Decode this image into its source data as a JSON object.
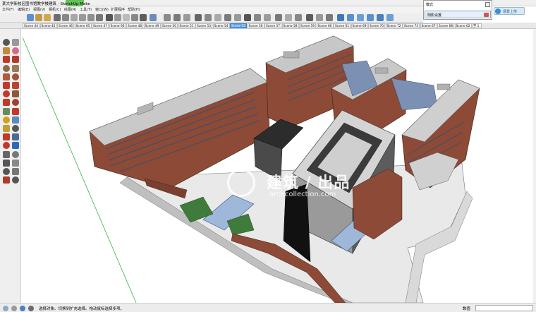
{
  "window": {
    "title": "某大学新校区图书馆教学楼建筑 - SketchUp Make"
  },
  "menu": {
    "items": [
      "文件(F)",
      "编辑(E)",
      "视图(V)",
      "相机(C)",
      "绘图(R)",
      "工具(T)",
      "窗口(W)",
      "扩展程序",
      "帮助(H)"
    ]
  },
  "mode_panel": {
    "label": "模式",
    "shadow_setting": "阴影设置"
  },
  "upload_button": {
    "label": "场景上传"
  },
  "scenes": {
    "tabs": [
      "Scene 44",
      "Scene 45",
      "Scene 46",
      "Scene 65",
      "Scene 47",
      "Scene 66",
      "Scene 48",
      "Scene 49",
      "Scene 50",
      "Scene 51",
      "Scene 53",
      "Scene 54",
      "Scene 55",
      "Scene 56",
      "Scene 57",
      "Scene 58",
      "Scene 59",
      "Scene 60",
      "Scene 61",
      "Scene 69",
      "Scene 70",
      "Scene 72",
      "Scene 73",
      "Scene 67",
      "Scene 68",
      "Scene 62",
      "字 1"
    ],
    "active": "Scene 55"
  },
  "watermark": {
    "cn": "建筑 / 出品",
    "en": "archcollection.com"
  },
  "status": {
    "message": "选择对象。切换到扩充选择。拖动鼠标选择多项。",
    "measure_label": "数值",
    "measure_value": ""
  },
  "colors": {
    "brick": "#8c4a37",
    "roof": "#c7c7c7",
    "active_tab": "#5a9fe0",
    "axis_green": "#3cb043"
  }
}
